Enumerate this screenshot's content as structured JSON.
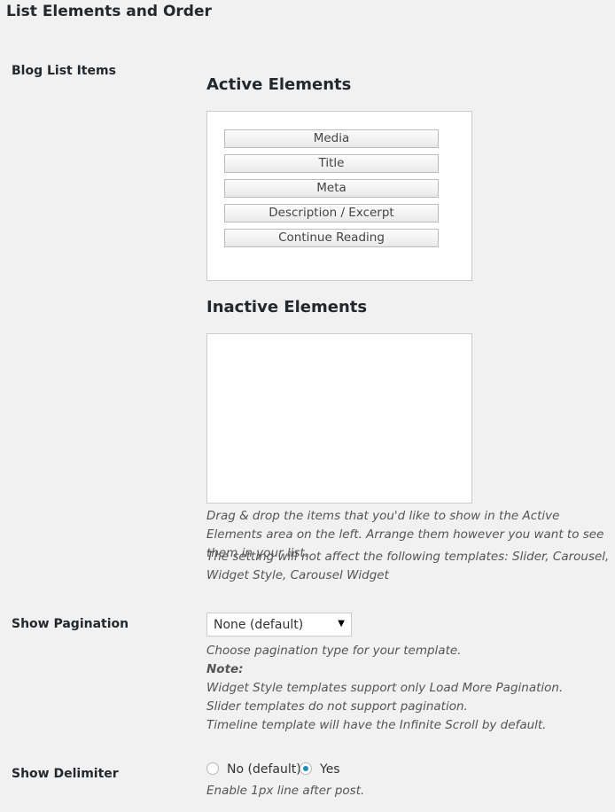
{
  "section": {
    "title": "List Elements and Order"
  },
  "blog_list": {
    "label": "Blog List Items",
    "active_heading": "Active Elements",
    "active_items": [
      "Media",
      "Title",
      "Meta",
      "Description / Excerpt",
      "Continue Reading"
    ],
    "inactive_heading": "Inactive Elements",
    "help_1": "Drag & drop the items that you'd like to show in the Active Elements area on the left. Arrange them however you want to see them in your list.",
    "help_2": "The setting will not affect the following templates: Slider, Carousel, Widget Style, Carousel Widget"
  },
  "pagination": {
    "label": "Show Pagination",
    "selected": "None (default)",
    "help": "Choose pagination type for your template.",
    "note_label": "Note:",
    "note_1": "Widget Style templates support only Load More Pagination.",
    "note_2": "Slider templates do not support pagination.",
    "note_3": "Timeline template will have the Infinite Scroll by default."
  },
  "delimiter": {
    "label": "Show Delimiter",
    "option_no": "No (default)",
    "option_yes": "Yes",
    "selected": "Yes",
    "help": "Enable 1px line after post."
  },
  "colors": {
    "radio_accent": "#1e8cbe",
    "border": "#cccccc",
    "background": "#f1f1f1"
  }
}
